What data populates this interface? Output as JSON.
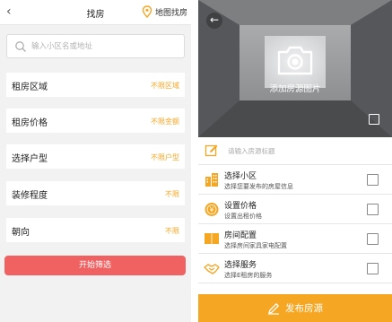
{
  "left": {
    "header": {
      "title": "找房",
      "map_label": "地图找房"
    },
    "search": {
      "placeholder": "输入小区名或地址"
    },
    "filters": [
      {
        "name": "租房区域",
        "value": "不限区域"
      },
      {
        "name": "租房价格",
        "value": "不限金额"
      },
      {
        "name": "选择户型",
        "value": "不限户型"
      },
      {
        "name": "装修程度",
        "value": "不限"
      },
      {
        "name": "朝向",
        "value": "不限"
      }
    ],
    "start_button": "开始筛选"
  },
  "right": {
    "photo_caption": "添加房源图片",
    "title_placeholder": "请输入房源标题",
    "options": [
      {
        "title": "选择小区",
        "subtitle": "选择您要发布的房屋信息",
        "icon": "building-icon"
      },
      {
        "title": "设置价格",
        "subtitle": "设置出租价格",
        "icon": "coin-icon"
      },
      {
        "title": "房间配置",
        "subtitle": "选择房间家具家电配置",
        "icon": "book-icon"
      },
      {
        "title": "选择服务",
        "subtitle": "选择E租房的服务",
        "icon": "handshake-icon"
      }
    ],
    "publish_button": "发布房源"
  },
  "colors": {
    "accent": "#f5a623",
    "danger": "#f06262",
    "background": "#f2f2f2"
  }
}
